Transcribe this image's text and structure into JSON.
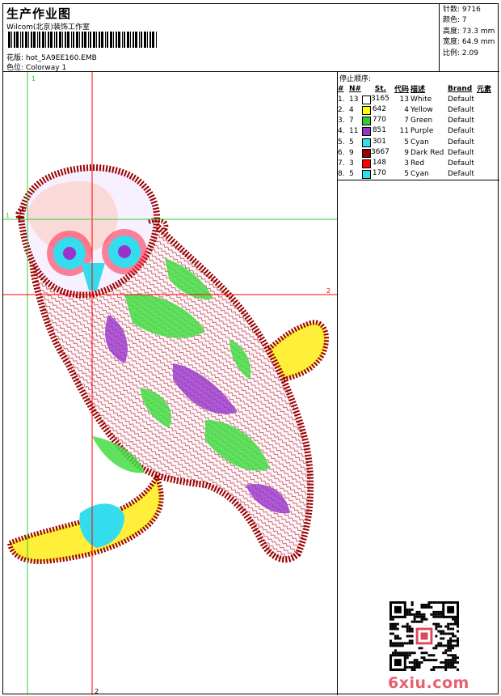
{
  "header": {
    "title": "生产作业图",
    "company": "Wilcom(北京)装饰工作室",
    "design_label": "花版:",
    "design_file": "hot_5A9EE160.EMB",
    "color_label": "色位:",
    "colorway": "Colorway 1"
  },
  "stats": {
    "stitches_label": "针数:",
    "stitches": "9716",
    "colors_label": "颜色:",
    "colors": "7",
    "height_label": "高度:",
    "height": "73.3 mm",
    "width_label": "宽度:",
    "width": "64.9 mm",
    "scale_label": "比例:",
    "scale": "2.09"
  },
  "stop_sequence": {
    "heading": "停止顺序:",
    "columns": [
      "#",
      "N#",
      "St.",
      "代码",
      "描述",
      "Brand",
      "元素"
    ],
    "rows": [
      {
        "seq": "1.",
        "needle": "13",
        "color": "#ffffff",
        "stitches": "3165",
        "code": "13",
        "desc": "White",
        "brand": "Default"
      },
      {
        "seq": "2.",
        "needle": "4",
        "color": "#ffff00",
        "stitches": "642",
        "code": "4",
        "desc": "Yellow",
        "brand": "Default"
      },
      {
        "seq": "3.",
        "needle": "7",
        "color": "#33cc33",
        "stitches": "770",
        "code": "7",
        "desc": "Green",
        "brand": "Default"
      },
      {
        "seq": "4.",
        "needle": "11",
        "color": "#9933cc",
        "stitches": "851",
        "code": "11",
        "desc": "Purple",
        "brand": "Default"
      },
      {
        "seq": "5.",
        "needle": "5",
        "color": "#33ddee",
        "stitches": "301",
        "code": "5",
        "desc": "Cyan",
        "brand": "Default"
      },
      {
        "seq": "6.",
        "needle": "9",
        "color": "#990000",
        "stitches": "3667",
        "code": "9",
        "desc": "Dark Red",
        "brand": "Default"
      },
      {
        "seq": "7.",
        "needle": "3",
        "color": "#ff0000",
        "stitches": "148",
        "code": "3",
        "desc": "Red",
        "brand": "Default"
      },
      {
        "seq": "8.",
        "needle": "5",
        "color": "#33ddee",
        "stitches": "170",
        "code": "5",
        "desc": "Cyan",
        "brand": "Default"
      }
    ]
  },
  "guides": {
    "v1": "1",
    "v2": "2",
    "h1": "1",
    "h2": "2"
  },
  "footer": {
    "logo": "6xiu.com",
    "qr_icon": "qr-code-icon"
  }
}
